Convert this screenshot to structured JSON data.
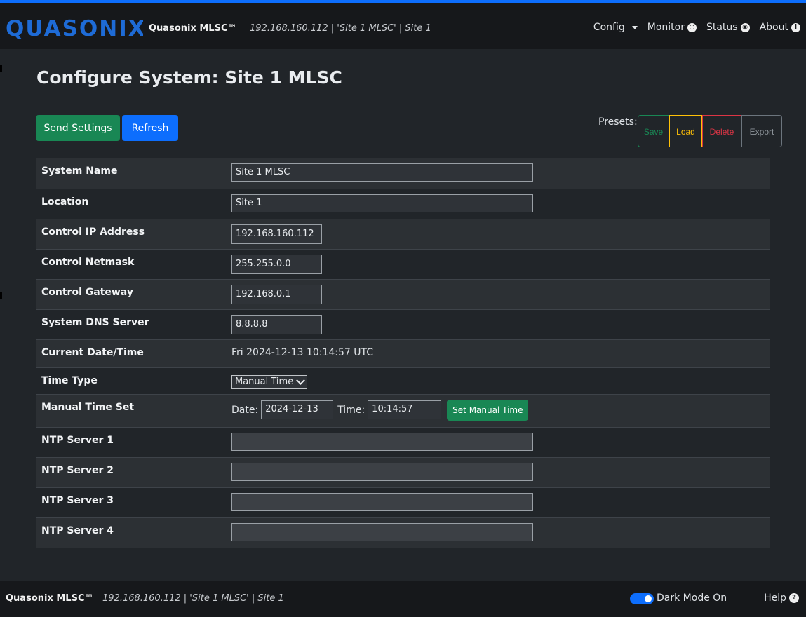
{
  "navbar": {
    "logo_text": "QUASONIX",
    "brand": "Quasonix MLSC™",
    "subtitle": "192.168.160.112 | 'Site 1 MLSC' | Site 1",
    "menu": [
      {
        "label": "Config",
        "icon": "caret-down-icon"
      },
      {
        "label": "Monitor",
        "icon": "clock-icon",
        "glyph": "◷"
      },
      {
        "label": "Status",
        "icon": "eye-icon",
        "glyph": "◉"
      },
      {
        "label": "About",
        "icon": "info-icon",
        "glyph": "i"
      }
    ]
  },
  "page": {
    "title": "Configure System: Site 1 MLSC"
  },
  "actions": {
    "send_label": "Send Settings",
    "refresh_label": "Refresh"
  },
  "presets": {
    "label": "Presets:",
    "save": "Save",
    "load": "Load",
    "delete": "Delete",
    "export": "Export"
  },
  "settings": {
    "system_name": {
      "label": "System Name",
      "value": "Site 1 MLSC"
    },
    "location": {
      "label": "Location",
      "value": "Site 1"
    },
    "control_ip": {
      "label": "Control IP Address",
      "value": "192.168.160.112"
    },
    "control_netmask": {
      "label": "Control Netmask",
      "value": "255.255.0.0"
    },
    "control_gateway": {
      "label": "Control Gateway",
      "value": "192.168.0.1"
    },
    "dns_server": {
      "label": "System DNS Server",
      "value": "8.8.8.8"
    },
    "current_datetime": {
      "label": "Current Date/Time",
      "value": "Fri 2024-12-13 10:14:57 UTC"
    },
    "time_type": {
      "label": "Time Type",
      "value": "Manual Time"
    },
    "manual_time_set": {
      "label": "Manual Time Set",
      "date_label": "Date:",
      "date_value": "2024-12-13",
      "time_label": "Time:",
      "time_value": "10:14:57",
      "button": "Set Manual Time"
    },
    "ntp1": {
      "label": "NTP Server 1",
      "value": ""
    },
    "ntp2": {
      "label": "NTP Server 2",
      "value": ""
    },
    "ntp3": {
      "label": "NTP Server 3",
      "value": ""
    },
    "ntp4": {
      "label": "NTP Server 4",
      "value": ""
    }
  },
  "footer": {
    "brand": "Quasonix MLSC™",
    "subtitle": "192.168.160.112 | 'Site 1 MLSC' | Site 1",
    "dark_mode_label": "Dark Mode On",
    "dark_mode_on": true,
    "help_label": "Help",
    "help_glyph": "?"
  },
  "colors": {
    "accent": "#0d6efd",
    "success": "#198754",
    "warning": "#ffc107",
    "danger": "#dc3545",
    "secondary": "#6c757d",
    "logo": "#1e6bd6"
  }
}
